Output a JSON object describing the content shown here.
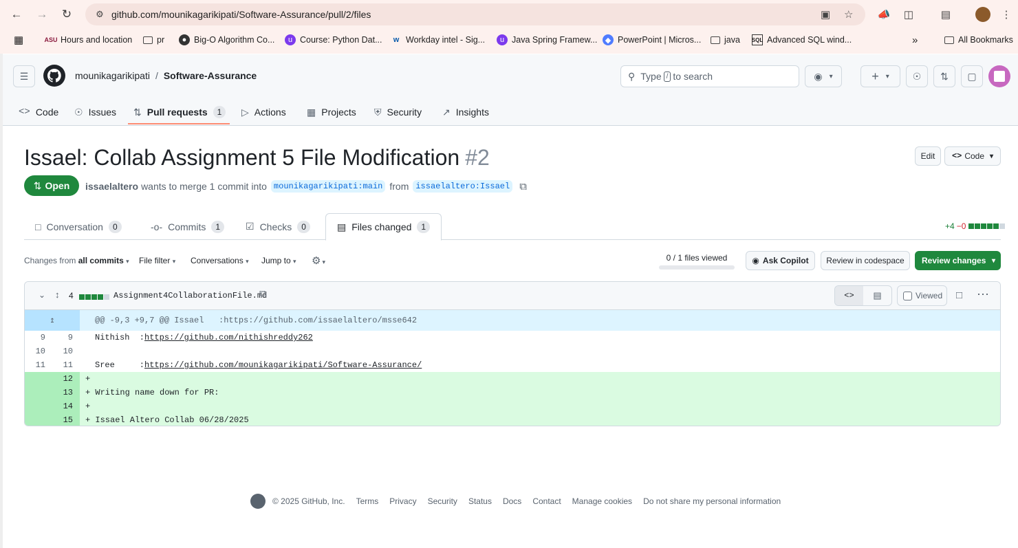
{
  "browser": {
    "url": "github.com/mounikagarikipati/Software-Assurance/pull/2/files",
    "bookmarks": [
      {
        "label": "Hours and location",
        "icon": "asu-icon"
      },
      {
        "label": "pr",
        "icon": "folder-icon"
      },
      {
        "label": "Big-O Algorithm Co...",
        "icon": "globe-icon"
      },
      {
        "label": "Course: Python Dat...",
        "icon": "course-icon"
      },
      {
        "label": "Workday intel - Sig...",
        "icon": "workday-icon"
      },
      {
        "label": "Java Spring Framew...",
        "icon": "course-icon"
      },
      {
        "label": "PowerPoint | Micros...",
        "icon": "copilot-icon"
      },
      {
        "label": "java",
        "icon": "folder-icon"
      },
      {
        "label": "Advanced SQL wind...",
        "icon": "sql-icon"
      }
    ],
    "more_bookmarks": "»",
    "all_bookmarks": "All Bookmarks"
  },
  "header": {
    "owner": "mounikagarikipati",
    "separator": "/",
    "repo": "Software-Assurance",
    "search_prefix": "Type",
    "search_key": "/",
    "search_suffix": "to search"
  },
  "repo_tabs": [
    {
      "label": "Code"
    },
    {
      "label": "Issues"
    },
    {
      "label": "Pull requests",
      "count": "1"
    },
    {
      "label": "Actions"
    },
    {
      "label": "Projects"
    },
    {
      "label": "Security"
    },
    {
      "label": "Insights"
    }
  ],
  "pr": {
    "title": "Issael: Collab Assignment 5 File Modification",
    "number": "#2",
    "edit_label": "Edit",
    "code_label": "Code",
    "state": "Open",
    "author": "issaelaltero",
    "merge_text": "wants to merge 1 commit into",
    "base_branch": "mounikagarikipati:main",
    "from_text": "from",
    "head_branch": "issaelaltero:Issael"
  },
  "pr_tabs": [
    {
      "label": "Conversation",
      "count": "0"
    },
    {
      "label": "Commits",
      "count": "1"
    },
    {
      "label": "Checks",
      "count": "0"
    },
    {
      "label": "Files changed",
      "count": "1"
    }
  ],
  "diffstat": {
    "additions": "+4",
    "deletions": "−0"
  },
  "toolbar": {
    "changes_from_prefix": "Changes from",
    "changes_from_value": "all commits",
    "file_filter": "File filter",
    "conversations": "Conversations",
    "jump_to": "Jump to",
    "files_viewed": "0 / 1 files viewed",
    "ask_copilot": "Ask Copilot",
    "review_codespace": "Review in codespace",
    "review_changes": "Review changes"
  },
  "file": {
    "changes": "4",
    "name": "Assignment4CollaborationFile.md",
    "viewed_label": "Viewed",
    "hunk_header": "@@ -9,3 +9,7 @@ Issael   :https://github.com/issaelaltero/msse642",
    "lines": [
      {
        "old": "9",
        "new": "9",
        "prefix": "Nithish  :",
        "link": "https://github.com/nithishreddy262",
        "type": "context"
      },
      {
        "old": "10",
        "new": "10",
        "prefix": "",
        "link": "",
        "type": "context"
      },
      {
        "old": "11",
        "new": "11",
        "prefix": "Sree     :",
        "link": "https://github.com/mounikagarikipati/Software-Assurance/",
        "type": "context"
      },
      {
        "old": "",
        "new": "12",
        "prefix": "+",
        "link": "",
        "type": "add"
      },
      {
        "old": "",
        "new": "13",
        "prefix": "+ Writing name down for PR:",
        "link": "",
        "type": "add"
      },
      {
        "old": "",
        "new": "14",
        "prefix": "+",
        "link": "",
        "type": "add"
      },
      {
        "old": "",
        "new": "15",
        "prefix": "+ Issael Altero Collab 06/28/2025",
        "link": "",
        "type": "add"
      }
    ]
  },
  "footer": {
    "copyright": "© 2025 GitHub, Inc.",
    "links": [
      "Terms",
      "Privacy",
      "Security",
      "Status",
      "Docs",
      "Contact",
      "Manage cookies",
      "Do not share my personal information"
    ]
  },
  "colors": {
    "green": "#1f883d",
    "accent": "#fd8c73",
    "link_blue": "#0969da",
    "add_bg": "#dafbe1",
    "add_num_bg": "#aceebb",
    "hunk_bg": "#ddf4ff"
  }
}
